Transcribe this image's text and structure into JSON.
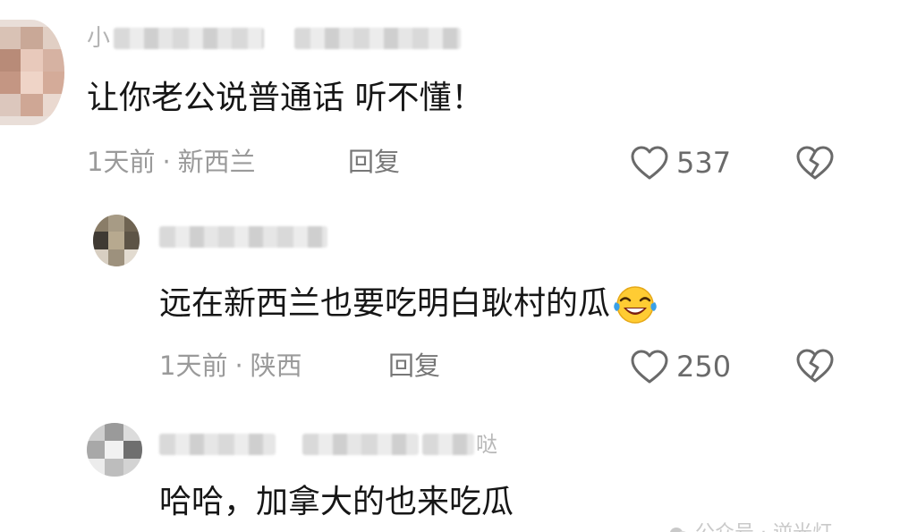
{
  "comments": [
    {
      "username_visible": "小",
      "username_tail": "",
      "text": "让你老公说普通话 听不懂！",
      "time": "1天前",
      "location": "新西兰",
      "reply_label": "回复",
      "likes": "537"
    },
    {
      "username_visible": "",
      "username_tail": "",
      "text": "远在新西兰也要吃明白耿村的瓜",
      "time": "1天前",
      "location": "陕西",
      "reply_label": "回复",
      "likes": "250"
    },
    {
      "username_visible": "",
      "username_tail": "哒",
      "text": "哈哈，加拿大的也来吃瓜"
    }
  ],
  "meta_separator": "·",
  "icons": {
    "like": "heart-outline-icon",
    "dislike": "broken-heart-icon",
    "emoji": "crying-laughing-emoji",
    "watermark": "wechat-official-account-icon"
  },
  "watermark": "公众号 · 逆光灯",
  "colors": {
    "text": "#161616",
    "meta": "#9a9a9a",
    "reply": "#777777",
    "icon": "#6a6a6a"
  }
}
